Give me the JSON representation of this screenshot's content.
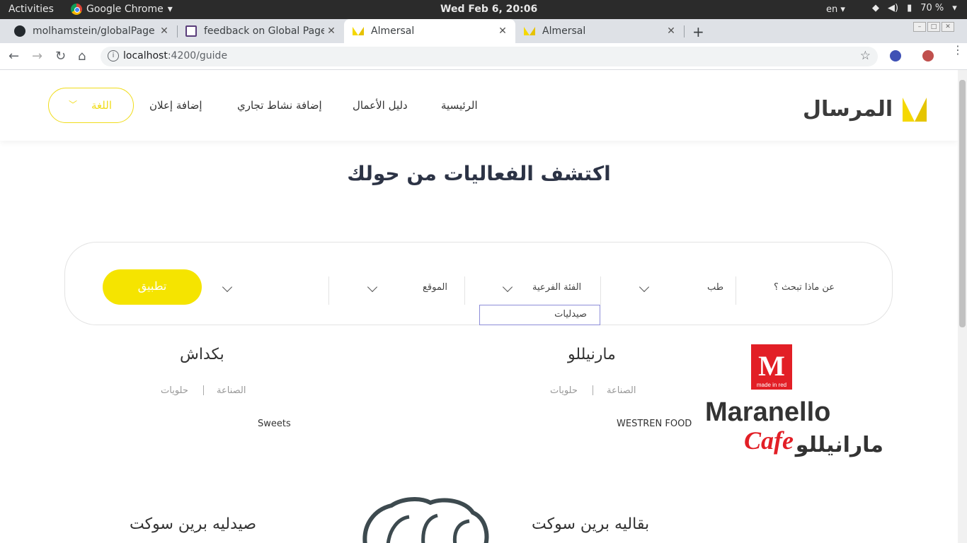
{
  "os": {
    "activities": "Activities",
    "app_name": "Google Chrome",
    "clock": "Wed Feb  6, 20:06",
    "lang": "en",
    "battery": "70 %"
  },
  "tabs": [
    {
      "title": "molhamstein/globalPage",
      "icon": "github-icon"
    },
    {
      "title": "feedback on Global Pages",
      "icon": "document-icon"
    },
    {
      "title": "Almersal",
      "icon": "almersal-icon",
      "active": true
    },
    {
      "title": "Almersal",
      "icon": "almersal-icon"
    }
  ],
  "address": {
    "host": "localhost",
    "path": ":4200/guide"
  },
  "site": {
    "logo_text": "المرسال",
    "nav": {
      "home": "الرئيسية",
      "directory": "دليل الأعمال",
      "add_business": "إضافة نشاط تجاري",
      "add_ad": "إضافة إعلان"
    },
    "lang_label": "اللغة",
    "hero_title": "اكتشف الفعاليات من حولك"
  },
  "search": {
    "what_label": "عن ماذا تبحث ؟",
    "category_value": "طب",
    "subcategory_label": "الفئة الفرعية",
    "location_label": "الموقع",
    "apply": "تطبيق",
    "dropdown_option": "صيدليات"
  },
  "listings": [
    {
      "title": "مارنيللو",
      "category": "الصناعة",
      "subcategory": "حلويات",
      "description": "WESTREN FOOD"
    },
    {
      "title": "بكداش",
      "category": "الصناعة",
      "subcategory": "حلويات",
      "description": "Sweets"
    },
    {
      "title": "بقاليه برين سوكت"
    },
    {
      "title": "صيدليه برين سوكت"
    }
  ],
  "maranello_logo": {
    "badge": "made in red",
    "wordmark": "Maranello",
    "script": "Cafe",
    "arabic": "مارانيللو"
  },
  "colors": {
    "brand_yellow": "#f5e400",
    "text_dark": "#2c3345",
    "os_bar": "#2b2b2b"
  }
}
